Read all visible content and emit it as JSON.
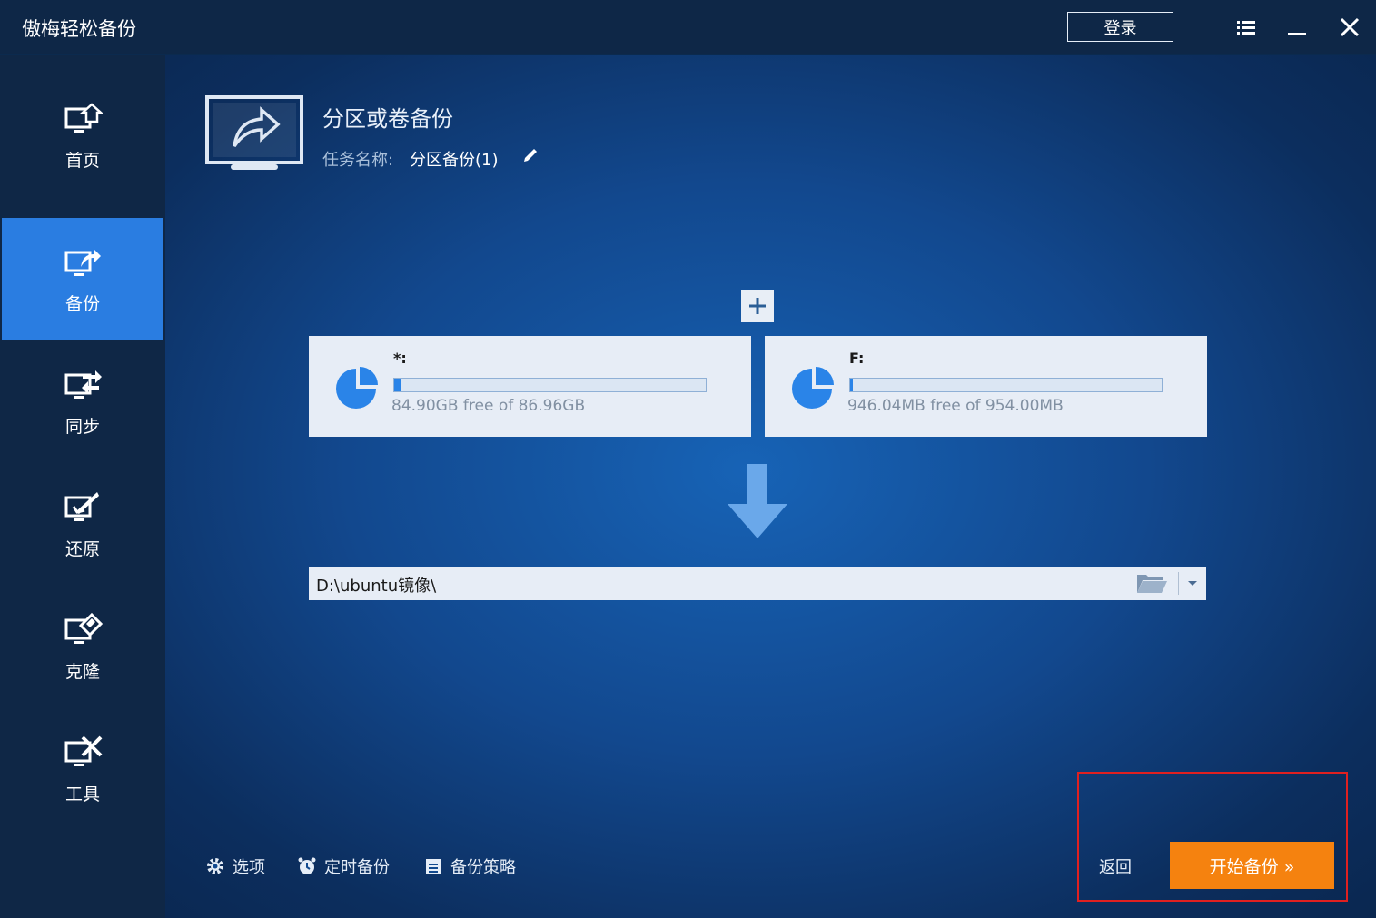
{
  "app": {
    "title": "傲梅轻松备份",
    "login_label": "登录"
  },
  "window_controls": [
    "menu-icon",
    "minimize-icon",
    "close-icon"
  ],
  "sidebar": {
    "items": [
      {
        "label": "首页",
        "icon": "home-icon",
        "active": false
      },
      {
        "label": "备份",
        "icon": "backup-icon",
        "active": true
      },
      {
        "label": "同步",
        "icon": "sync-icon",
        "active": false
      },
      {
        "label": "还原",
        "icon": "restore-icon",
        "active": false
      },
      {
        "label": "克隆",
        "icon": "clone-icon",
        "active": false
      },
      {
        "label": "工具",
        "icon": "tools-icon",
        "active": false
      }
    ]
  },
  "header": {
    "title": "分区或卷备份",
    "task_name_label": "任务名称:",
    "task_name_value": "分区备份(1)"
  },
  "source": {
    "add_label": "+",
    "partitions": [
      {
        "drive": "*:",
        "free_text": "84.90GB free of 86.96GB",
        "used_fraction": 0.024
      },
      {
        "drive": "F:",
        "free_text": "946.04MB free of 954.00MB",
        "used_fraction": 0.008
      }
    ]
  },
  "destination": {
    "path": "D:\\ubuntu镜像\\"
  },
  "bottom": {
    "options_label": "选项",
    "schedule_label": "定时备份",
    "scheme_label": "备份策略",
    "back_label": "返回",
    "start_label": "开始备份 »"
  },
  "colors": {
    "accent": "#2a7de1",
    "start_button": "#f5820f",
    "highlight": "#e02020",
    "bar_fill": "#2a84e8"
  }
}
